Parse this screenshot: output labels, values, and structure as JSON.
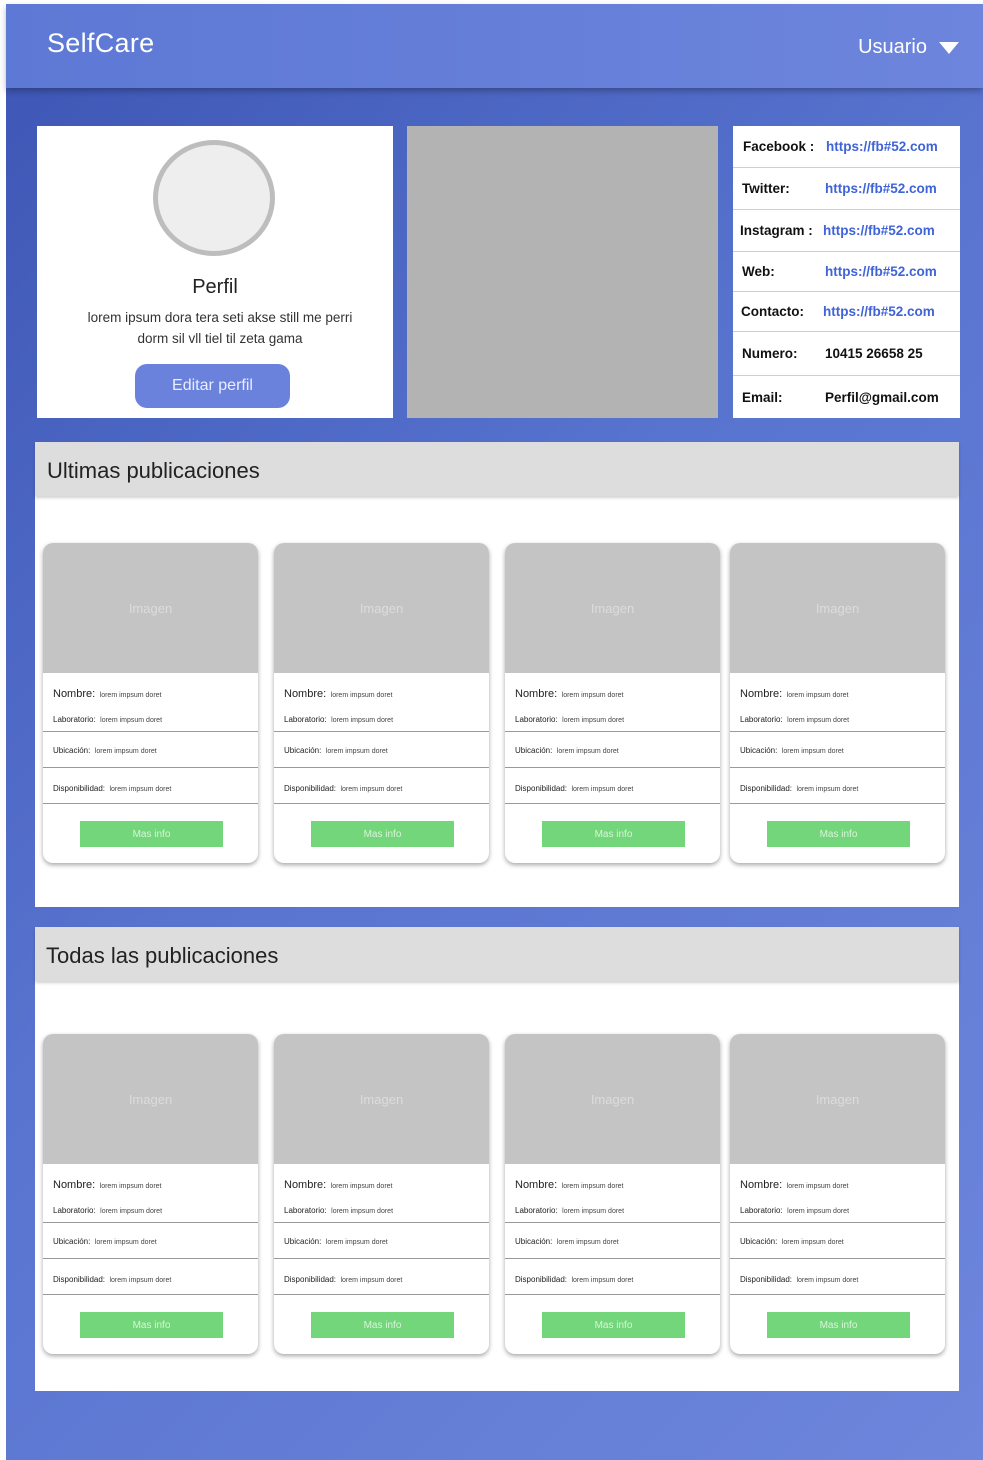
{
  "navbar": {
    "brand": "SelfCare",
    "user_label": "Usuario"
  },
  "profile": {
    "title": "Perfil",
    "description": "lorem ipsum dora tera seti akse still me perri dorm sil vll tiel til zeta gama",
    "edit_label": "Editar perfil"
  },
  "social": [
    {
      "key": "Facebook :",
      "value": "https://fb#52.com"
    },
    {
      "key": "Twitter:",
      "value": "https://fb#52.com"
    },
    {
      "key": "Instagram :",
      "value": "https://fb#52.com"
    },
    {
      "key": "Web:",
      "value": "https://fb#52.com"
    },
    {
      "key": "Contacto:",
      "value": "https://fb#52.com"
    },
    {
      "key": "Numero:",
      "value": "10415 26658 25"
    },
    {
      "key": "Email:",
      "value": "Perfil@gmail.com"
    }
  ],
  "latest": {
    "title": "Ultimas publicaciones",
    "cards": [
      {
        "image_label": "Imagen",
        "nombre_label": "Nombre:",
        "nombre_value": "lorem impsum doret",
        "lab_label": "Laboratorio:",
        "lab_value": "lorem impsum doret",
        "ubic_label": "Ubicación:",
        "ubic_value": "lorem impsum doret",
        "disp_label": "Disponibilidad:",
        "disp_value": "lorem impsum doret",
        "button": "Mas info"
      },
      {
        "image_label": "Imagen",
        "nombre_label": "Nombre:",
        "nombre_value": "lorem impsum doret",
        "lab_label": "Laboratorio:",
        "lab_value": "lorem impsum doret",
        "ubic_label": "Ubicación:",
        "ubic_value": "lorem impsum doret",
        "disp_label": "Disponibilidad:",
        "disp_value": "lorem impsum doret",
        "button": "Mas info"
      },
      {
        "image_label": "Imagen",
        "nombre_label": "Nombre:",
        "nombre_value": "lorem impsum doret",
        "lab_label": "Laboratorio:",
        "lab_value": "lorem impsum doret",
        "ubic_label": "Ubicación:",
        "ubic_value": "lorem impsum doret",
        "disp_label": "Disponibilidad:",
        "disp_value": "lorem impsum doret",
        "button": "Mas info"
      },
      {
        "image_label": "Imagen",
        "nombre_label": "Nombre:",
        "nombre_value": "lorem impsum doret",
        "lab_label": "Laboratorio:",
        "lab_value": "lorem impsum doret",
        "ubic_label": "Ubicación:",
        "ubic_value": "lorem impsum doret",
        "disp_label": "Disponibilidad:",
        "disp_value": "lorem impsum doret",
        "button": "Mas info"
      }
    ]
  },
  "all": {
    "title": "Todas las publicaciones",
    "cards": [
      {
        "image_label": "Imagen",
        "nombre_label": "Nombre:",
        "nombre_value": "lorem impsum doret",
        "lab_label": "Laboratorio:",
        "lab_value": "lorem impsum doret",
        "ubic_label": "Ubicación:",
        "ubic_value": "lorem impsum doret",
        "disp_label": "Disponibilidad:",
        "disp_value": "lorem impsum doret",
        "button": "Mas info"
      },
      {
        "image_label": "Imagen",
        "nombre_label": "Nombre:",
        "nombre_value": "lorem impsum doret",
        "lab_label": "Laboratorio:",
        "lab_value": "lorem impsum doret",
        "ubic_label": "Ubicación:",
        "ubic_value": "lorem impsum doret",
        "disp_label": "Disponibilidad:",
        "disp_value": "lorem impsum doret",
        "button": "Mas info"
      },
      {
        "image_label": "Imagen",
        "nombre_label": "Nombre:",
        "nombre_value": "lorem impsum doret",
        "lab_label": "Laboratorio:",
        "lab_value": "lorem impsum doret",
        "ubic_label": "Ubicación:",
        "ubic_value": "lorem impsum doret",
        "disp_label": "Disponibilidad:",
        "disp_value": "lorem impsum doret",
        "button": "Mas info"
      },
      {
        "image_label": "Imagen",
        "nombre_label": "Nombre:",
        "nombre_value": "lorem impsum doret",
        "lab_label": "Laboratorio:",
        "lab_value": "lorem impsum doret",
        "ubic_label": "Ubicación:",
        "ubic_value": "lorem impsum doret",
        "disp_label": "Disponibilidad:",
        "disp_value": "lorem impsum doret",
        "button": "Mas info"
      }
    ]
  },
  "colors": {
    "navbar": "#6d85dc",
    "primary_button": "#6b82dc",
    "more_info_button": "#74d67a",
    "link": "#3f63d8",
    "placeholder": "#b3b3b3"
  }
}
